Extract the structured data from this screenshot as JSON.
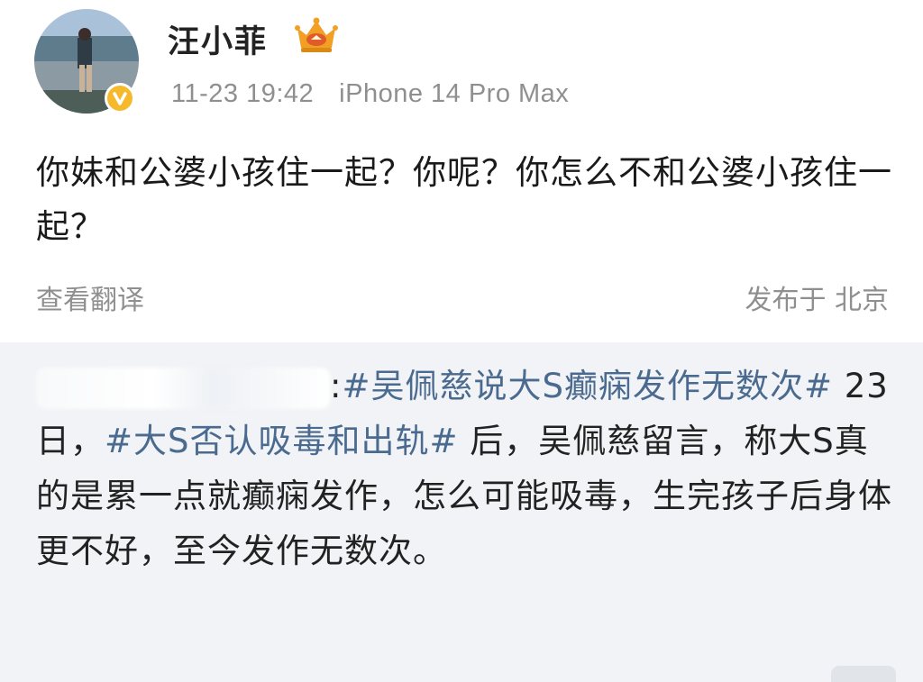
{
  "user": {
    "name": "汪小菲",
    "avatar_icon": "avatar-photo-icon",
    "verified_icon": "verified-badge-icon",
    "crown_icon": "crown-badge-icon"
  },
  "post": {
    "time": "11-23 19:42",
    "device": "iPhone 14 Pro Max",
    "text": "你妹和公婆小孩住一起？你呢？你怎么不和公婆小孩住一起？",
    "translate_label": "查看翻译",
    "location": "发布于 北京"
  },
  "repost": {
    "separator": ":",
    "tag1": "#吴佩慈说大S癫痫发作无数次#",
    "mid": " 23日，",
    "tag2": "#大S否认吸毒和出轨#",
    "rest": " 后，吴佩慈留言，称大S真的是累一点就癫痫发作，怎么可能吸毒，生完孩子后身体更不好，至今发作无数次。"
  },
  "colors": {
    "tag": "#4a6a8f",
    "meta": "#8f8f8f",
    "repost_bg": "#f1f3f6",
    "crown": "#f2a024"
  }
}
